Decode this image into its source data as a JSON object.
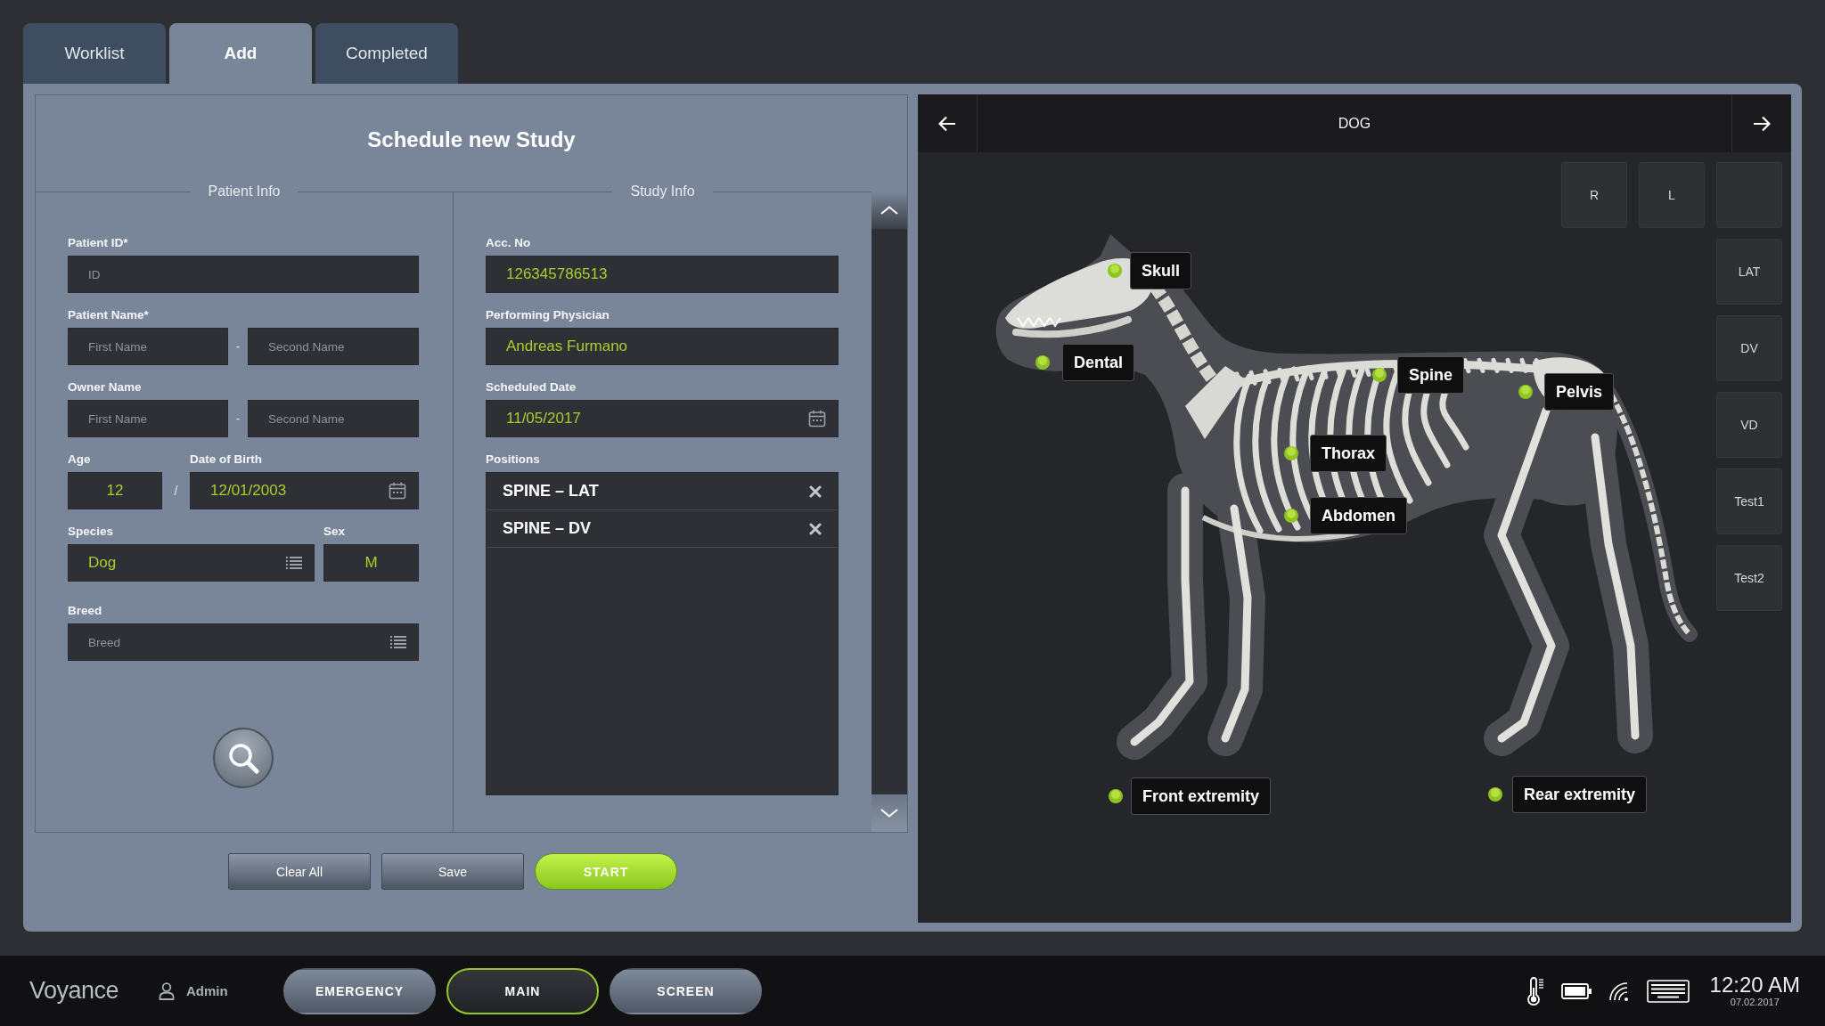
{
  "tabs": [
    {
      "label": "Worklist",
      "selected": false
    },
    {
      "label": "Add",
      "selected": true
    },
    {
      "label": "Completed",
      "selected": false
    }
  ],
  "form": {
    "title": "Schedule new Study",
    "patient_info": {
      "heading": "Patient Info",
      "patient_id": {
        "label": "Patient ID*",
        "placeholder": "ID"
      },
      "patient_name": {
        "label": "Patient Name*",
        "first": {
          "placeholder": "First Name"
        },
        "separator": "-",
        "second": {
          "placeholder": "Second Name"
        }
      },
      "owner_name": {
        "label": "Owner Name",
        "first": {
          "placeholder": "First Name"
        },
        "separator": "-",
        "second": {
          "placeholder": "Second Name"
        }
      },
      "age": {
        "label": "Age",
        "value": "12"
      },
      "age_separator": "/",
      "date_of_birth": {
        "label": "Date of Birth",
        "value": "12/01/2003"
      },
      "species": {
        "label": "Species",
        "value": "Dog"
      },
      "sex": {
        "label": "Sex",
        "value": "M"
      },
      "breed": {
        "label": "Breed",
        "placeholder": "Breed"
      }
    },
    "study_info": {
      "heading": "Study Info",
      "acc_no": {
        "label": "Acc. No",
        "value": "126345786513"
      },
      "performing_physician": {
        "label": "Performing Physician",
        "value": "Andreas Furmano"
      },
      "scheduled_date": {
        "label": "Scheduled Date",
        "value": "11/05/2017"
      },
      "positions": {
        "label": "Positions",
        "items": [
          "SPINE – LAT",
          "SPINE – DV"
        ]
      }
    },
    "buttons": [
      {
        "label": "Clear All",
        "kind": "secondary"
      },
      {
        "label": "Save",
        "kind": "secondary"
      },
      {
        "label": "START",
        "kind": "primary"
      }
    ]
  },
  "body_map": {
    "title": "DOG",
    "side_buttons": [
      {
        "kind": "text",
        "label": "R"
      },
      {
        "kind": "text",
        "label": "L"
      },
      {
        "kind": "blank"
      }
    ],
    "view_buttons": [
      "LAT",
      "DV",
      "VD",
      "Test1",
      "Test2"
    ],
    "regions": [
      "Skull",
      "Dental",
      "Spine",
      "Pelvis",
      "Thorax",
      "Abdomen",
      "Front extremity",
      "Rear extremity"
    ]
  },
  "status_bar": {
    "logo": "Voyance",
    "user": "Admin",
    "modes": [
      {
        "label": "EMERGENCY",
        "selected": false
      },
      {
        "label": "MAIN",
        "selected": true
      },
      {
        "label": "SCREEN",
        "selected": false
      }
    ],
    "time": "12:20 AM",
    "date": "07.02.2017"
  }
}
